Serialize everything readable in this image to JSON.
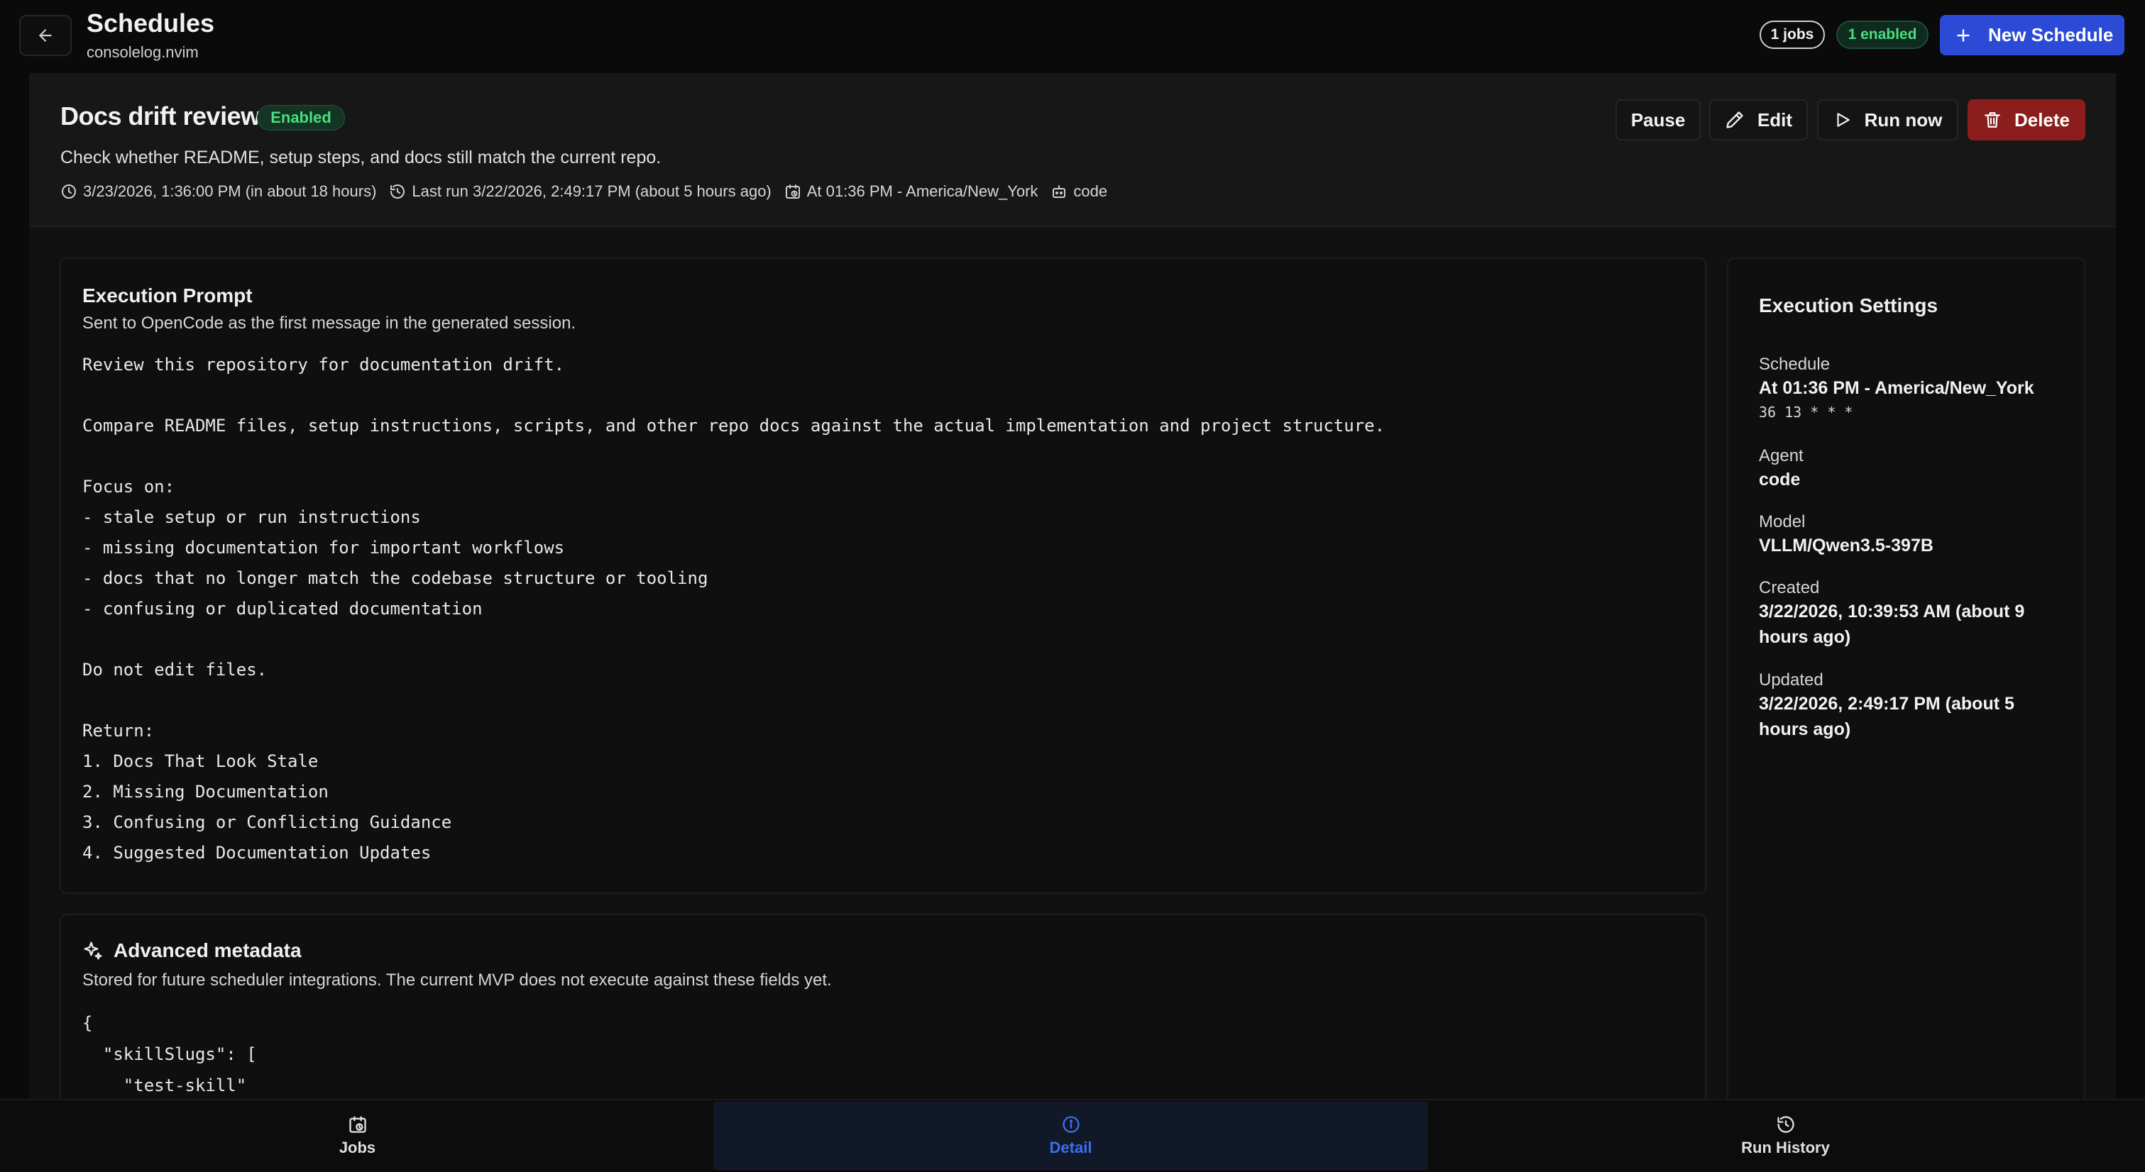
{
  "header": {
    "title": "Schedules",
    "subtitle": "consolelog.nvim",
    "jobs_pill": "1 jobs",
    "enabled_pill": "1 enabled",
    "new_button": "New Schedule",
    "back_icon": "arrow-left-icon"
  },
  "job": {
    "title": "Docs drift review",
    "status_badge": "Enabled",
    "description": "Check whether README, setup steps, and docs still match the current repo.",
    "meta": {
      "next_run": "3/23/2026, 1:36:00 PM (in about 18 hours)",
      "last_run": "Last run 3/22/2026, 2:49:17 PM (about 5 hours ago)",
      "schedule": "At 01:36 PM - America/New_York",
      "agent": "code"
    },
    "actions": {
      "pause": "Pause",
      "edit": "Edit",
      "run_now": "Run now",
      "delete": "Delete"
    }
  },
  "prompt": {
    "title": "Execution Prompt",
    "subtitle": "Sent to OpenCode as the first message in the generated session.",
    "body": "Review this repository for documentation drift.\n\nCompare README files, setup instructions, scripts, and other repo docs against the actual implementation and project structure.\n\nFocus on:\n- stale setup or run instructions\n- missing documentation for important workflows\n- docs that no longer match the codebase structure or tooling\n- confusing or duplicated documentation\n\nDo not edit files.\n\nReturn:\n1. Docs That Look Stale\n2. Missing Documentation\n3. Confusing or Conflicting Guidance\n4. Suggested Documentation Updates"
  },
  "advanced": {
    "title": "Advanced metadata",
    "subtitle": "Stored for future scheduler integrations. The current MVP does not execute against these fields yet.",
    "json": "{\n  \"skillSlugs\": [\n    \"test-skill\""
  },
  "settings": {
    "title": "Execution Settings",
    "schedule_label": "Schedule",
    "schedule_value": "At 01:36 PM - America/New_York",
    "cron": "36 13 * * *",
    "agent_label": "Agent",
    "agent_value": "code",
    "model_label": "Model",
    "model_value": "VLLM/Qwen3.5-397B",
    "created_label": "Created",
    "created_value": "3/22/2026, 10:39:53 AM (about 9 hours ago)",
    "updated_label": "Updated",
    "updated_value": "3/22/2026, 2:49:17 PM (about 5 hours ago)"
  },
  "nav": {
    "jobs": "Jobs",
    "detail": "Detail",
    "run_history": "Run History",
    "active": "Detail"
  },
  "colors": {
    "accent": "#2b4bd6",
    "enabled_green": "#4ade80",
    "delete_red": "#8b1d1d",
    "active_tab": "#3b6ef0"
  }
}
